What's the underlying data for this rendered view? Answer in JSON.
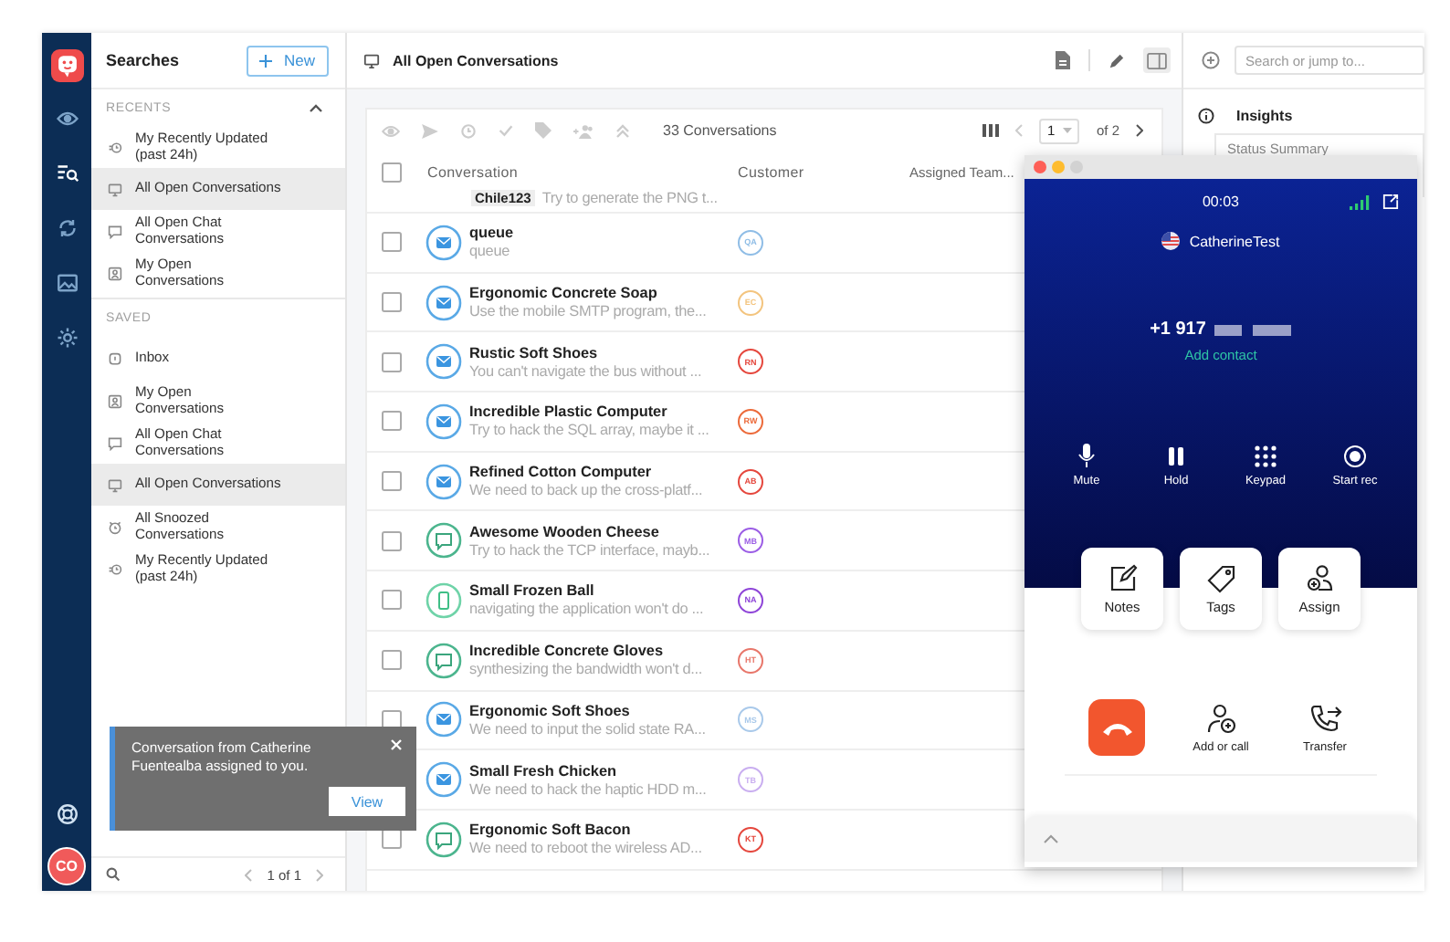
{
  "nav": {
    "items": [
      {
        "kind": "eye",
        "selected": false
      },
      {
        "kind": "searches",
        "selected": true
      },
      {
        "kind": "sync",
        "selected": false
      },
      {
        "kind": "media",
        "selected": false
      },
      {
        "kind": "settings",
        "selected": false
      }
    ],
    "avatar": "CO"
  },
  "sidebar": {
    "title": "Searches",
    "new_button": "New",
    "sections": [
      {
        "title": "RECENTS",
        "expanded": true,
        "items": [
          {
            "kind": "recent",
            "label": "My Recently Updated (past 24h)",
            "selected": false
          },
          {
            "kind": "monitor",
            "label": "All Open Conversations",
            "selected": true
          },
          {
            "kind": "chat",
            "label": "All Open Chat Conversations",
            "selected": false
          },
          {
            "kind": "person",
            "label": "My Open Conversations",
            "selected": false
          }
        ]
      },
      {
        "title": "SAVED",
        "items": [
          {
            "kind": "inbox",
            "label": "Inbox",
            "selected": false
          },
          {
            "kind": "person",
            "label": "My Open Conversations",
            "selected": false
          },
          {
            "kind": "chat",
            "label": "All Open Chat Conversations",
            "selected": false
          },
          {
            "kind": "monitor",
            "label": "All Open Conversations",
            "selected": true
          },
          {
            "kind": "snooze",
            "label": "All Snoozed Conversations",
            "selected": false
          },
          {
            "kind": "recent",
            "label": "My Recently Updated (past 24h)",
            "selected": false
          }
        ]
      }
    ],
    "pagination": "1 of 1"
  },
  "main": {
    "title": "All Open Conversations",
    "select_all_checked": false,
    "count": "33 Conversations",
    "page": "1",
    "page_total": "of 2",
    "columns": [
      "Conversation",
      "Customer",
      "Assigned Team..."
    ],
    "partial_row": {
      "tag": "Chile123",
      "preview": "Try to generate the PNG t..."
    },
    "rows": [
      {
        "kind": "email",
        "checked": false,
        "title": "queue",
        "preview": "queue",
        "customer": {
          "initials": "QA",
          "color": "#8fbde6"
        }
      },
      {
        "kind": "email",
        "checked": false,
        "title": "Ergonomic Concrete Soap",
        "preview": "Use the mobile SMTP program, the...",
        "customer": {
          "initials": "EC",
          "color": "#f3c47e"
        }
      },
      {
        "kind": "email",
        "checked": false,
        "title": "Rustic Soft Shoes",
        "preview": "You can't navigate the bus without ...",
        "customer": {
          "initials": "RN",
          "color": "#e5473d"
        }
      },
      {
        "kind": "email",
        "checked": false,
        "title": "Incredible Plastic Computer",
        "preview": "Try to hack the SQL array, maybe it ...",
        "customer": {
          "initials": "RW",
          "color": "#ec6a3a"
        }
      },
      {
        "kind": "email",
        "checked": false,
        "title": "Refined Cotton Computer",
        "preview": "We need to back up the cross-platf...",
        "customer": {
          "initials": "AB",
          "color": "#e5473d"
        }
      },
      {
        "kind": "chat",
        "checked": false,
        "title": "Awesome Wooden Cheese",
        "preview": "Try to hack the TCP interface, mayb...",
        "customer": {
          "initials": "MB",
          "color": "#9b5de5"
        }
      },
      {
        "kind": "sms",
        "checked": false,
        "title": "Small Frozen Ball",
        "preview": "navigating the application won't do ...",
        "customer": {
          "initials": "NA",
          "color": "#8e44d8"
        }
      },
      {
        "kind": "chat",
        "checked": false,
        "title": "Incredible Concrete Gloves",
        "preview": "synthesizing the bandwidth won't d...",
        "customer": {
          "initials": "HT",
          "color": "#e8766a"
        }
      },
      {
        "kind": "email",
        "checked": false,
        "title": "Ergonomic Soft Shoes",
        "preview": "We need to input the solid state RA...",
        "customer": {
          "initials": "MS",
          "color": "#a9c9ea"
        }
      },
      {
        "kind": "email",
        "title": "Small Fresh Chicken",
        "preview": "We need to hack the haptic HDD m...",
        "customer": {
          "initials": "TB",
          "color": "#c9aef0"
        }
      },
      {
        "kind": "chat",
        "checked": false,
        "title": "Ergonomic Soft Bacon",
        "preview": "We need to reboot the wireless AD...",
        "customer": {
          "initials": "KT",
          "color": "#e5473d"
        }
      }
    ]
  },
  "insights": {
    "search": {
      "placeholder": "Search or jump to..."
    },
    "title": "Insights",
    "card_title": "Status Summary"
  },
  "call": {
    "timer": "00:03",
    "contact": "CatherineTest",
    "number": "+1 917",
    "add_contact": "Add contact",
    "controls": [
      {
        "kind": "mute",
        "label": "Mute"
      },
      {
        "kind": "hold",
        "label": "Hold"
      },
      {
        "kind": "keypad",
        "label": "Keypad"
      },
      {
        "kind": "record",
        "label": "Start rec"
      }
    ],
    "actions": [
      {
        "kind": "notes",
        "label": "Notes"
      },
      {
        "kind": "tags",
        "label": "Tags"
      },
      {
        "kind": "assign",
        "label": "Assign"
      }
    ],
    "bottom": [
      {
        "kind": "add",
        "label": "Add or call"
      },
      {
        "kind": "transfer",
        "label": "Transfer"
      }
    ]
  },
  "toast": {
    "message": "Conversation from Catherine Fuentealba assigned to you.",
    "button": "View"
  }
}
